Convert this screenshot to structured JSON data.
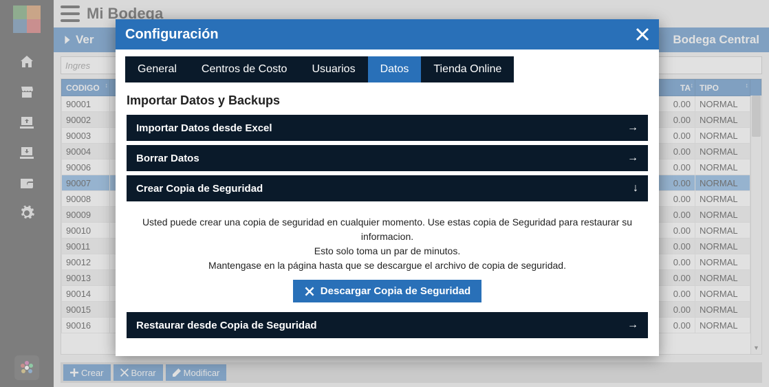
{
  "app": {
    "title": "Mi Bodega"
  },
  "tab_bar": {
    "left": "Ver",
    "right": "Bodega Central"
  },
  "search": {
    "placeholder": "Ingres"
  },
  "table": {
    "headers": [
      "CODIGO",
      "",
      "TA",
      "TIPO"
    ],
    "rows": [
      {
        "code": "90001",
        "ta": "0.00",
        "tipo": "NORMAL",
        "sel": false,
        "alt": false
      },
      {
        "code": "90002",
        "ta": "0.00",
        "tipo": "NORMAL",
        "sel": false,
        "alt": true
      },
      {
        "code": "90003",
        "ta": "0.00",
        "tipo": "NORMAL",
        "sel": false,
        "alt": false
      },
      {
        "code": "90004",
        "ta": "0.00",
        "tipo": "NORMAL",
        "sel": false,
        "alt": true
      },
      {
        "code": "90006",
        "ta": "0.00",
        "tipo": "NORMAL",
        "sel": false,
        "alt": false
      },
      {
        "code": "90007",
        "ta": "0.00",
        "tipo": "NORMAL",
        "sel": true,
        "alt": false
      },
      {
        "code": "90008",
        "ta": "0.00",
        "tipo": "NORMAL",
        "sel": false,
        "alt": false
      },
      {
        "code": "90009",
        "ta": "0.00",
        "tipo": "NORMAL",
        "sel": false,
        "alt": true
      },
      {
        "code": "90010",
        "ta": "0.00",
        "tipo": "NORMAL",
        "sel": false,
        "alt": false
      },
      {
        "code": "90011",
        "ta": "0.00",
        "tipo": "NORMAL",
        "sel": false,
        "alt": true
      },
      {
        "code": "90012",
        "ta": "0.00",
        "tipo": "NORMAL",
        "sel": false,
        "alt": false
      },
      {
        "code": "90013",
        "ta": "0.00",
        "tipo": "NORMAL",
        "sel": false,
        "alt": true
      },
      {
        "code": "90014",
        "ta": "0.00",
        "tipo": "NORMAL",
        "sel": false,
        "alt": false
      },
      {
        "code": "90015",
        "ta": "0.00",
        "tipo": "NORMAL",
        "sel": false,
        "alt": true
      },
      {
        "code": "90016",
        "ta": "0.00",
        "tipo": "NORMAL",
        "sel": false,
        "alt": false
      }
    ]
  },
  "actions": {
    "create": "Crear",
    "delete": "Borrar",
    "edit": "Modificar"
  },
  "modal": {
    "title": "Configuración",
    "tabs": [
      "General",
      "Centros de Costo",
      "Usuarios",
      "Datos",
      "Tienda Online"
    ],
    "active_tab": 3,
    "section_title": "Importar Datos y Backups",
    "items": {
      "import_excel": "Importar Datos desde Excel",
      "delete_data": "Borrar Datos",
      "create_backup": "Crear Copia de Seguridad",
      "restore_backup": "Restaurar desde Copia de Seguridad"
    },
    "backup_panel": {
      "line1": "Usted puede crear una copia de seguridad en cualquier momento. Use estas copia de Seguridad para restaurar su informacion.",
      "line2": "Esto solo toma un par de minutos.",
      "line3": "Mantengase en la página hasta que se descargue el archivo de copia de seguridad.",
      "button": "Descargar Copia de Seguridad"
    }
  }
}
